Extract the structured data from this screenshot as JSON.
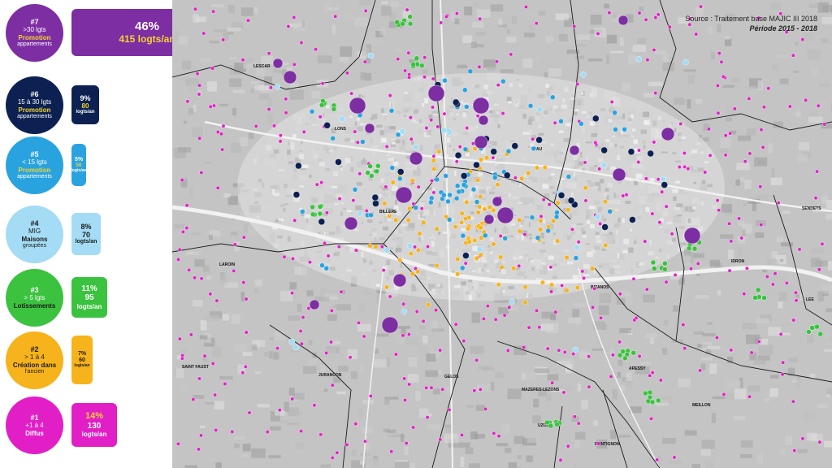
{
  "legend": [
    {
      "num": "#7",
      "l1": ">30 lgts",
      "l2": "Promotion",
      "l3": "appartements",
      "pct": "46%",
      "val": "415 logts/an",
      "color": "#7d2ea3",
      "box_color": "#7d2ea3",
      "text_color": "#ffffff",
      "l2_color": "#f3d42f"
    },
    {
      "num": "#6",
      "l1": "15 à 30 lgts",
      "l2": "Promotion",
      "l3": "appartements",
      "pct": "9%",
      "val": "80",
      "unit": "logts/an",
      "color": "#0c2152",
      "box_color": "#0c2152",
      "text_color": "#ffffff",
      "l2_color": "#f3d42f"
    },
    {
      "num": "#5",
      "l1": "< 15 lgts",
      "l2": "Promotion",
      "l3": "appartements",
      "pct": "5%",
      "val": "50",
      "unit": "logts/an",
      "color": "#29a3e0",
      "box_color": "#29a3e0",
      "text_color": "#ffffff",
      "l2_color": "#f3d42f"
    },
    {
      "num": "#4",
      "l1": "MIG",
      "l2": "Maisons",
      "l3": "groupées",
      "pct": "8%",
      "val": "70",
      "unit": "logts/an",
      "color": "#a4dcf5",
      "box_color": "#a4dcf5",
      "text_color": "#1a1a1a",
      "l2_color": "#1a1a1a"
    },
    {
      "num": "#3",
      "l1": "> 5 lgts",
      "l2": "Lotissements",
      "l3": "",
      "pct": "11%",
      "val": "95",
      "unit": "logts/an",
      "color": "#3bc23f",
      "box_color": "#3bc23f",
      "text_color": "#ffffff",
      "l2_color": "#1a1a1a"
    },
    {
      "num": "#2",
      "l1": "> 1 à 4",
      "l2": "Création dans",
      "l3": "l'ancien",
      "pct": "7%",
      "val": "60",
      "unit": "logts/an",
      "color": "#f6b31b",
      "box_color": "#f6b31b",
      "text_color": "#1a1a1a",
      "l2_color": "#1a1a1a"
    },
    {
      "num": "#1",
      "l1": "+1 à 4",
      "l2": "Diffus",
      "l3": "",
      "pct": "14%",
      "val": "130",
      "unit": "logts/an",
      "color": "#e21fc7",
      "box_color": "#e21fc7",
      "text_color": "#ffffff",
      "l2_color": "#ffffff"
    }
  ],
  "map": {
    "source": "Source : Traitement base MAJIC III 2018",
    "period": "Période 2015 - 2018",
    "places": [
      "LESCAR",
      "LONS",
      "PAU",
      "BILLERE",
      "LAROIN",
      "BIZANOS",
      "IDRON",
      "SENDETS",
      "LEE",
      "SAINT FAUST",
      "JURANCON",
      "GELOS",
      "MAZERES-LEZONS",
      "ARESSY",
      "MEILLON",
      "UZOS",
      "RONTIGNON"
    ]
  }
}
